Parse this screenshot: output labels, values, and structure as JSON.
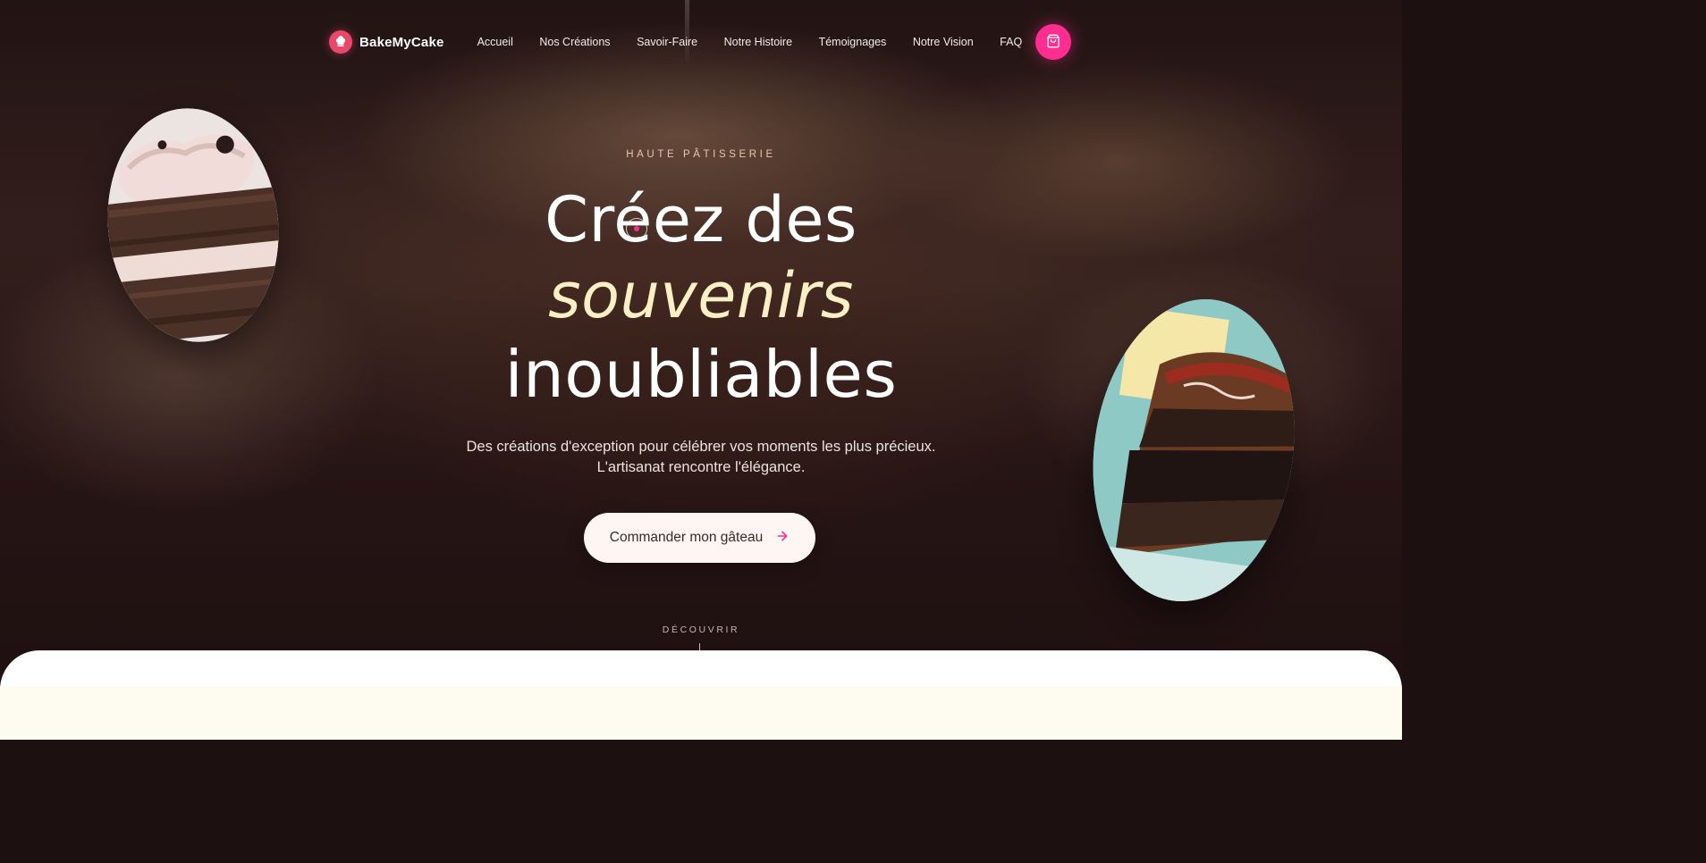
{
  "brand": {
    "name": "BakeMyCake",
    "accent": "#ff2d8f",
    "logo_color": "#e8486a"
  },
  "nav": {
    "items": [
      {
        "label": "Accueil"
      },
      {
        "label": "Nos Créations"
      },
      {
        "label": "Savoir-Faire"
      },
      {
        "label": "Notre Histoire"
      },
      {
        "label": "Témoignages"
      },
      {
        "label": "Notre Vision"
      },
      {
        "label": "FAQ"
      }
    ],
    "cart_icon": "shopping-bag-icon"
  },
  "hero": {
    "eyebrow": "HAUTE PÂTISSERIE",
    "title_line1": "Créez des",
    "title_line2": "souvenirs",
    "title_line3": "inoubliables",
    "subtitle_line1": "Des créations d'exception pour célébrer vos moments les plus précieux.",
    "subtitle_line2": "L'artisanat rencontre l'élégance.",
    "cta_label": "Commander mon gâteau",
    "cta_icon": "arrow-right-icon",
    "scroll_hint": "DÉCOUVRIR"
  }
}
